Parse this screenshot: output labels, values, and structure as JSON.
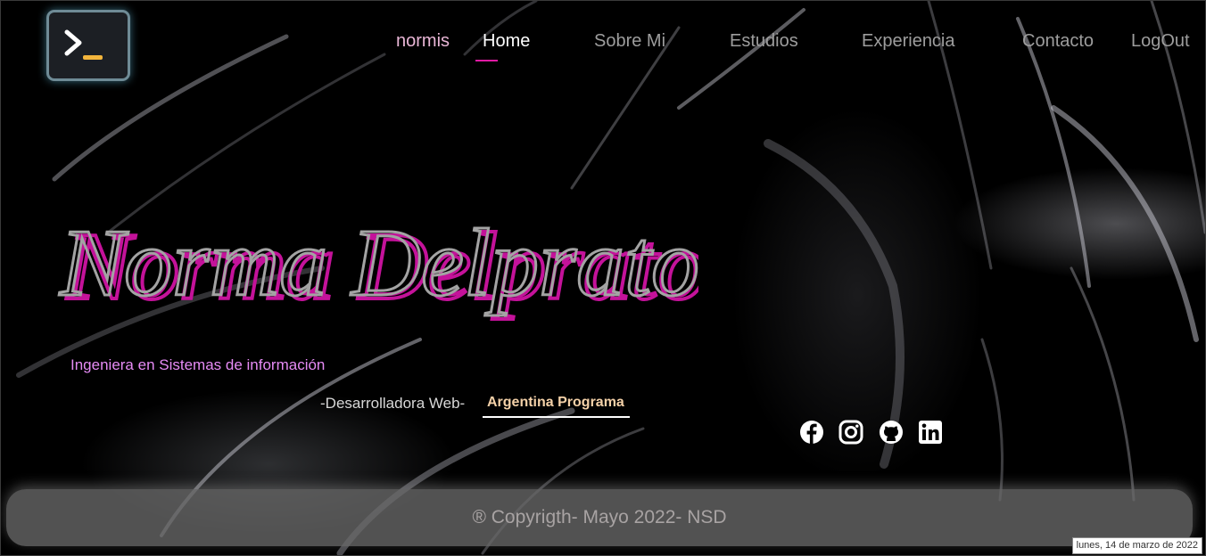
{
  "nav": {
    "brand": "normis",
    "items": [
      "Home",
      "Sobre Mi",
      "Estudios",
      "Experiencia",
      "Contacto",
      "LogOut"
    ],
    "active": "Home"
  },
  "hero": {
    "name": "Norma Delprato",
    "subtitle": "Ingeniera en Sistemas de información",
    "role": "-Desarrolladora Web-",
    "program": "Argentina Programa"
  },
  "social": {
    "icons": [
      "facebook-icon",
      "instagram-icon",
      "github-icon",
      "linkedin-icon"
    ]
  },
  "footer": {
    "text": "® Copyrigth- Mayo 2022- NSD"
  },
  "status": {
    "date": "lunes, 14 de marzo de 2022"
  },
  "colors": {
    "accent": "#e01aa3",
    "name_shadow": "#c4129a",
    "name_fill": "#9e9e9e",
    "subtitle": "#e68bf5",
    "program": "#f4d1a8"
  }
}
